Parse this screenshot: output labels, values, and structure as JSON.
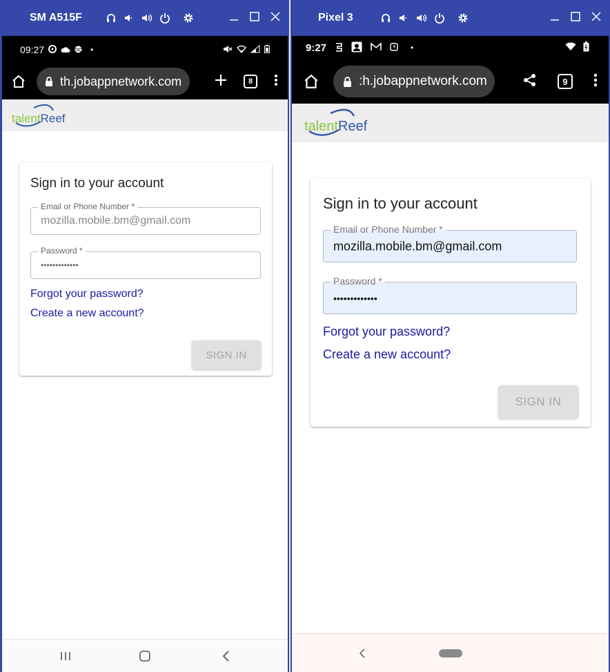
{
  "devices": [
    {
      "window_title": "SM A515F",
      "status": {
        "time": "09:27",
        "dot": "•"
      },
      "url": "th.jobappnetwork.com",
      "tab_count": "8",
      "brand": {
        "part1": "talent",
        "part2": "Reef"
      },
      "card": {
        "title": "Sign in to your account",
        "email_label": "Email or Phone Number *",
        "email_value": "mozilla.mobile.bm@gmail.com",
        "password_label": "Password *",
        "password_value": "•••••••••••••",
        "forgot_link": "Forgot your password?",
        "create_link": "Create a new account?",
        "signin_label": "SIGN IN"
      }
    },
    {
      "window_title": "Pixel 3",
      "status": {
        "time": "9:27",
        "dot": "•"
      },
      "url": ":h.jobappnetwork.com",
      "tab_count": "9",
      "brand": {
        "part1": "talent",
        "part2": "Reef"
      },
      "card": {
        "title": "Sign in to your account",
        "email_label": "Email or Phone Number *",
        "email_value": "mozilla.mobile.bm@gmail.com",
        "password_label": "Password *",
        "password_value": "•••••••••••••",
        "forgot_link": "Forgot your password?",
        "create_link": "Create a new account?",
        "signin_label": "SIGN IN"
      }
    }
  ],
  "colors": {
    "window_titlebar": "#3547a8",
    "link": "#1a1aa0",
    "logo_green": "#8dc63f",
    "logo_blue": "#2f5aa6",
    "autofill_bg": "#e8f0fe"
  }
}
